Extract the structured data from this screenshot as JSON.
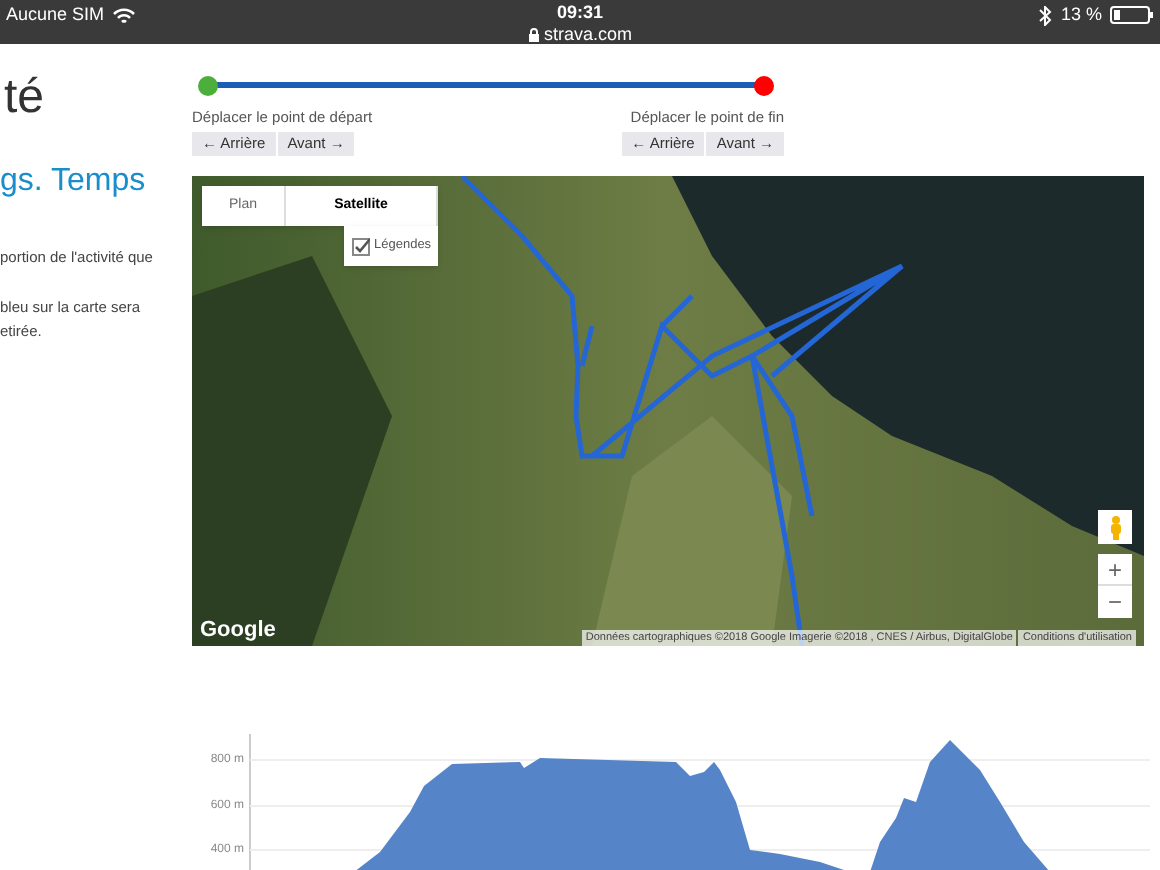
{
  "status_bar": {
    "carrier": "Aucune SIM",
    "time": "09:31",
    "url": "strava.com",
    "battery": "13 %"
  },
  "sidebar": {
    "title": "té",
    "subtitle": "gs. Temps",
    "paragraphs": [
      [
        "portion de l'activité que"
      ],
      [
        "bleu sur la carte sera",
        "etirée."
      ]
    ]
  },
  "range": {
    "start_label": "Déplacer le point de départ",
    "end_label": "Déplacer le point de fin",
    "start_buttons": [
      "← Arrière",
      "Avant →"
    ],
    "end_buttons": [
      "← Arrière",
      "Avant →"
    ]
  },
  "map": {
    "map_types": [
      {
        "label": "Plan",
        "selected": false
      },
      {
        "label": "Satellite",
        "selected": true
      }
    ],
    "legend": {
      "label": "Légendes",
      "checked": true
    },
    "zoom_in": "+",
    "zoom_out": "−",
    "logo": "Google",
    "attribution": "Données cartographiques ©2018 Google Imagerie ©2018 , CNES / Airbus, DigitalGlobe",
    "terms": "Conditions d'utilisation"
  },
  "elevation_chart": {
    "y_labels": [
      "800 m",
      "600 m",
      "400 m"
    ]
  }
}
